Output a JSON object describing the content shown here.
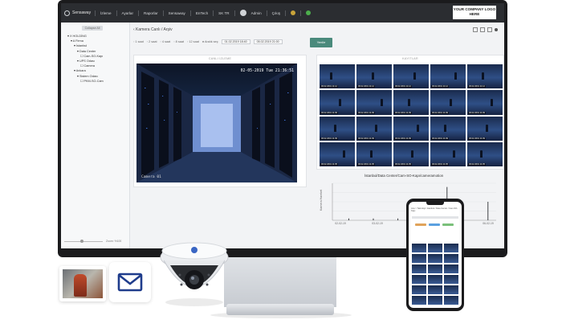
{
  "topbar": {
    "brand": "Sensaway",
    "nav": [
      "İzleme",
      "Ayarlar",
      "Raporlar",
      "Sensaway",
      "EnTech",
      "SK TR",
      "Admin",
      "Çıkış"
    ],
    "company_logo": "YOUR COMPANY LOGO HERE"
  },
  "sidebar": {
    "collapse_label": "Collapse All",
    "tree": [
      "▾ X HOLDİNG",
      "  ▾ A Firma",
      "    ▾ İstanbul",
      "      ▾ Data Center",
      "        ☐ Cam-SO-Kapı",
      "      ▾ UPS Odası",
      "        ☐ Camera",
      "    ▾ Ankara",
      "      ▾ Sistem Odası",
      "        ☐ PKM-SO-Cam"
    ],
    "zoom_label": "Zoom: %100"
  },
  "main": {
    "breadcrumb": "‹ Kamera Canlı / Arşiv",
    "filters": [
      "◦ 1 saat",
      "◦ 2 saat",
      "◦ 4 saat",
      "◦ 8 saat",
      "◦ 12 saat",
      "● Aralık seç"
    ],
    "date_from": "01.02.2019 18:40",
    "date_to": "05.02.2019 21:00",
    "submit_label": "Yenile",
    "live_title": "CANLI İZLEME",
    "live_timestamp": "02-05-2019 Tue 21:36:51",
    "live_camera": "Camera 01",
    "recordings_title": "KAYITLAR",
    "thumb_times": [
      "06.02.2019 11:12",
      "06.02.2019 11:12",
      "06.02.2019 11:12",
      "06.02.2019 11:12",
      "06.02.2019 11:12",
      "06.02.2019 11:09",
      "06.02.2019 11:09",
      "06.02.2019 11:09",
      "06.02.2019 11:09",
      "06.02.2019 11:09",
      "06.02.2019 11:09",
      "06.02.2019 11:09",
      "06.02.2019 11:09",
      "06.02.2019 11:09",
      "06.02.2019 11:09",
      "06.02.2019 11:05",
      "06.02.2019 11:05",
      "06.02.2019 11:05",
      "06.02.2019 11:05",
      "06.02.2019 11:05"
    ]
  },
  "chart_data": {
    "type": "bar",
    "title": "İstanbul/Data Center/Cam-SO-Kapı/cameramotion",
    "ylabel": "Kamera Hareket",
    "categories": [
      "02-02-19",
      "03-02-19",
      "04-02-19",
      "05-02-19",
      "06-02-19"
    ],
    "x": [
      0.1,
      0.25,
      0.4,
      0.48,
      0.55,
      0.62,
      0.64,
      0.66,
      0.7,
      0.72,
      0.74,
      0.76,
      0.8,
      0.95
    ],
    "values": [
      0.05,
      0.05,
      0.05,
      0.1,
      0.2,
      0.3,
      0.15,
      0.25,
      0.9,
      0.2,
      0.1,
      0.15,
      0.1,
      0.5
    ],
    "ylim": [
      0,
      1
    ],
    "grid": true
  },
  "phone": {
    "header": "Ana > Teknoloji / Istanbul / Data Center / Cam-SO-Kapı",
    "tab_colors": [
      "#e0a35a",
      "#5aa0e0",
      "#7ac07a"
    ]
  },
  "colors": {
    "accent": "#4a8a7c",
    "topbar": "#2b2d31",
    "sensaway_green": "#4cae4c"
  }
}
